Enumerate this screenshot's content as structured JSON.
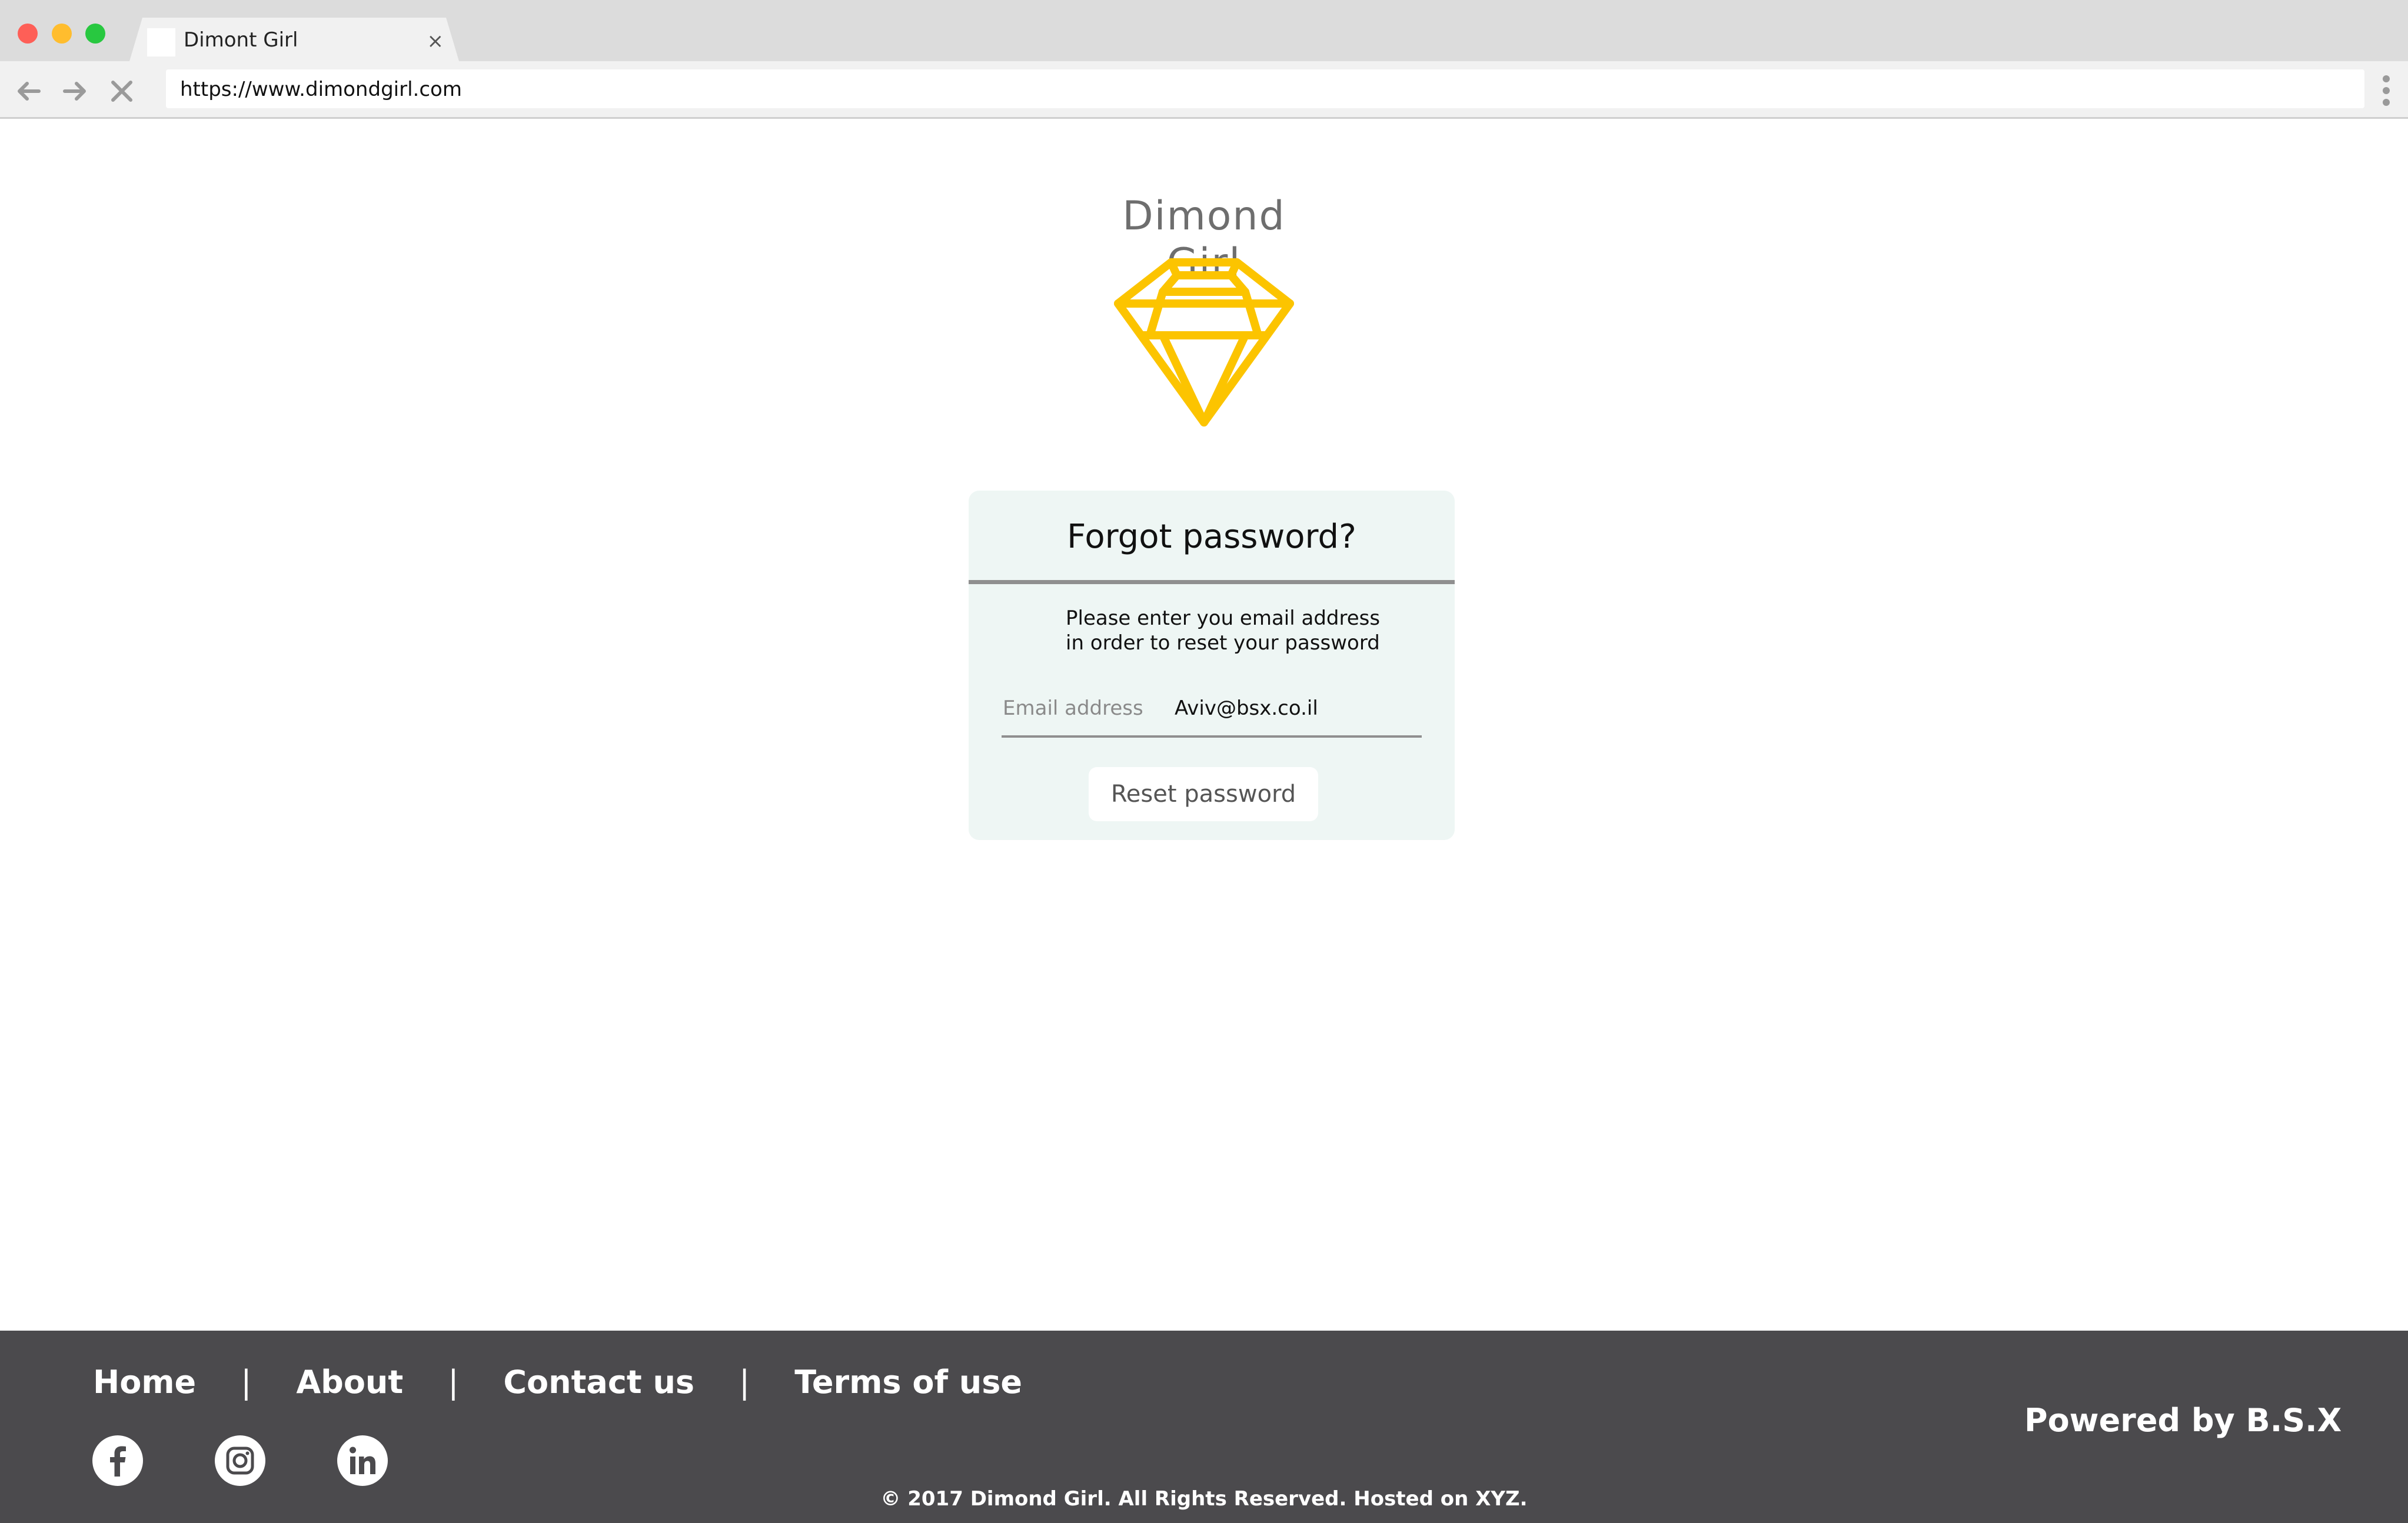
{
  "browser": {
    "tab_title": "Dimont Girl",
    "tab_close": "×",
    "url": "https://www.dimondgirl.com"
  },
  "brand": {
    "name": "Dimond Girl",
    "logo_icon": "diamond-icon",
    "logo_color": "#fcc400"
  },
  "reset_card": {
    "title": "Forgot password?",
    "description_line1": "Please enter you email address",
    "description_line2": "in order to reset your password",
    "email_label": "Email address",
    "email_value": "Aviv@bsx.co.il",
    "button_label": "Reset password"
  },
  "footer": {
    "links": [
      "Home",
      "About",
      "Contact us",
      "Terms of use"
    ],
    "separator": "|",
    "social_icons": [
      "facebook-icon",
      "instagram-icon",
      "linkedin-icon"
    ],
    "powered_by": "Powered by B.S.X",
    "copyright": "© 2017 Dimond Girl. All Rights Reserved. Hosted on XYZ.",
    "background": "#4b4a4d"
  }
}
